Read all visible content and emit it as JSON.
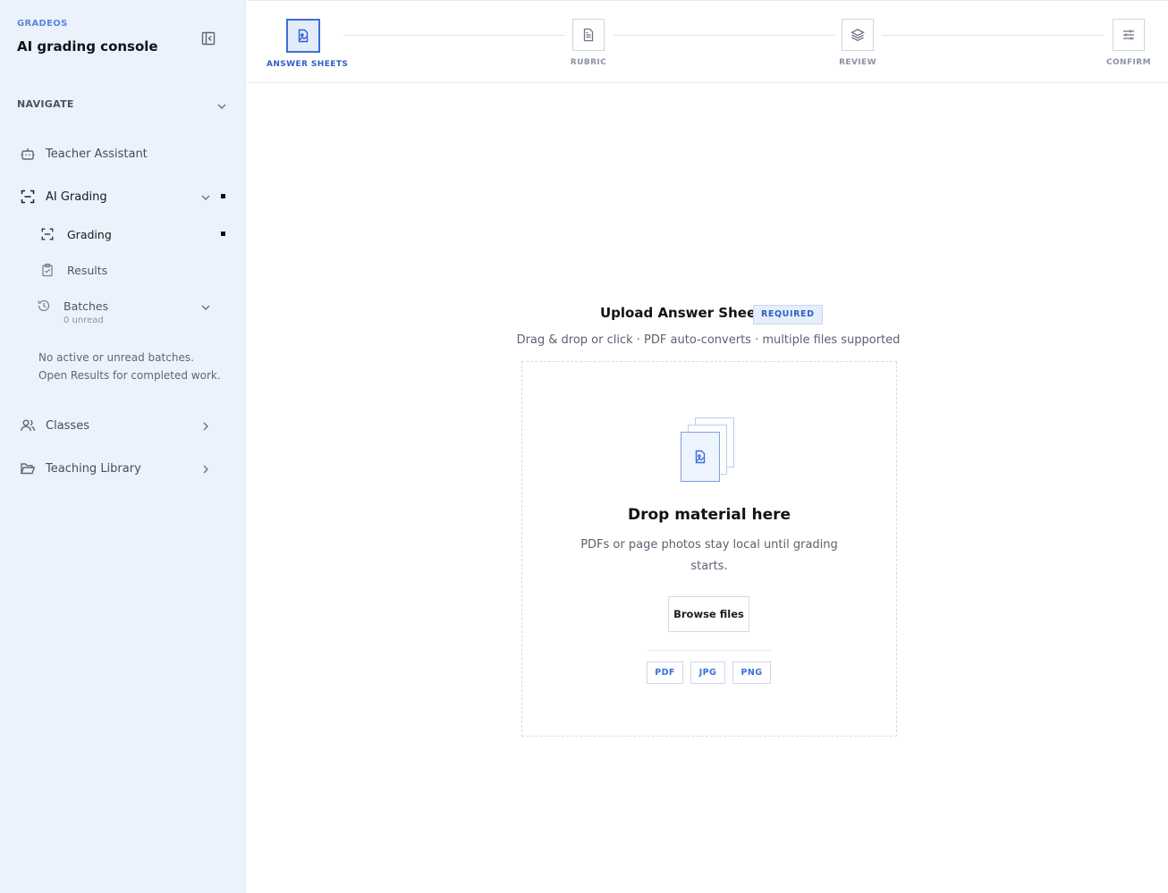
{
  "sidebar": {
    "brand": "GRADEOS",
    "title": "AI grading console",
    "nav_heading": "NAVIGATE",
    "items": {
      "teacher_assistant": "Teacher Assistant",
      "ai_grading": "AI Grading",
      "grading": "Grading",
      "results": "Results",
      "batches": "Batches",
      "batches_meta": "0 unread",
      "classes": "Classes",
      "teaching_library": "Teaching Library"
    },
    "batches_note": "No active or unread batches. Open Results for completed work."
  },
  "stepper": {
    "steps": [
      {
        "label": "ANSWER SHEETS",
        "icon": "image-file-icon",
        "state": "current"
      },
      {
        "label": "RUBRIC",
        "icon": "document-icon",
        "state": "pending"
      },
      {
        "label": "REVIEW",
        "icon": "layers-icon",
        "state": "pending"
      },
      {
        "label": "CONFIRM",
        "icon": "sliders-icon",
        "state": "pending"
      }
    ]
  },
  "upload": {
    "title": "Upload Answer Sheets",
    "badge": "REQUIRED",
    "subtitle": "Drag & drop or click · PDF auto-converts · multiple files supported",
    "drop_title": "Drop material here",
    "drop_desc": "PDFs or page photos stay local until grading starts.",
    "browse_label": "Browse files",
    "formats": [
      "PDF",
      "JPG",
      "PNG"
    ]
  },
  "colors": {
    "accent": "#3a6fd8",
    "sidebar_bg": "#ecf2fb",
    "badge_bg": "#e6eefb"
  }
}
